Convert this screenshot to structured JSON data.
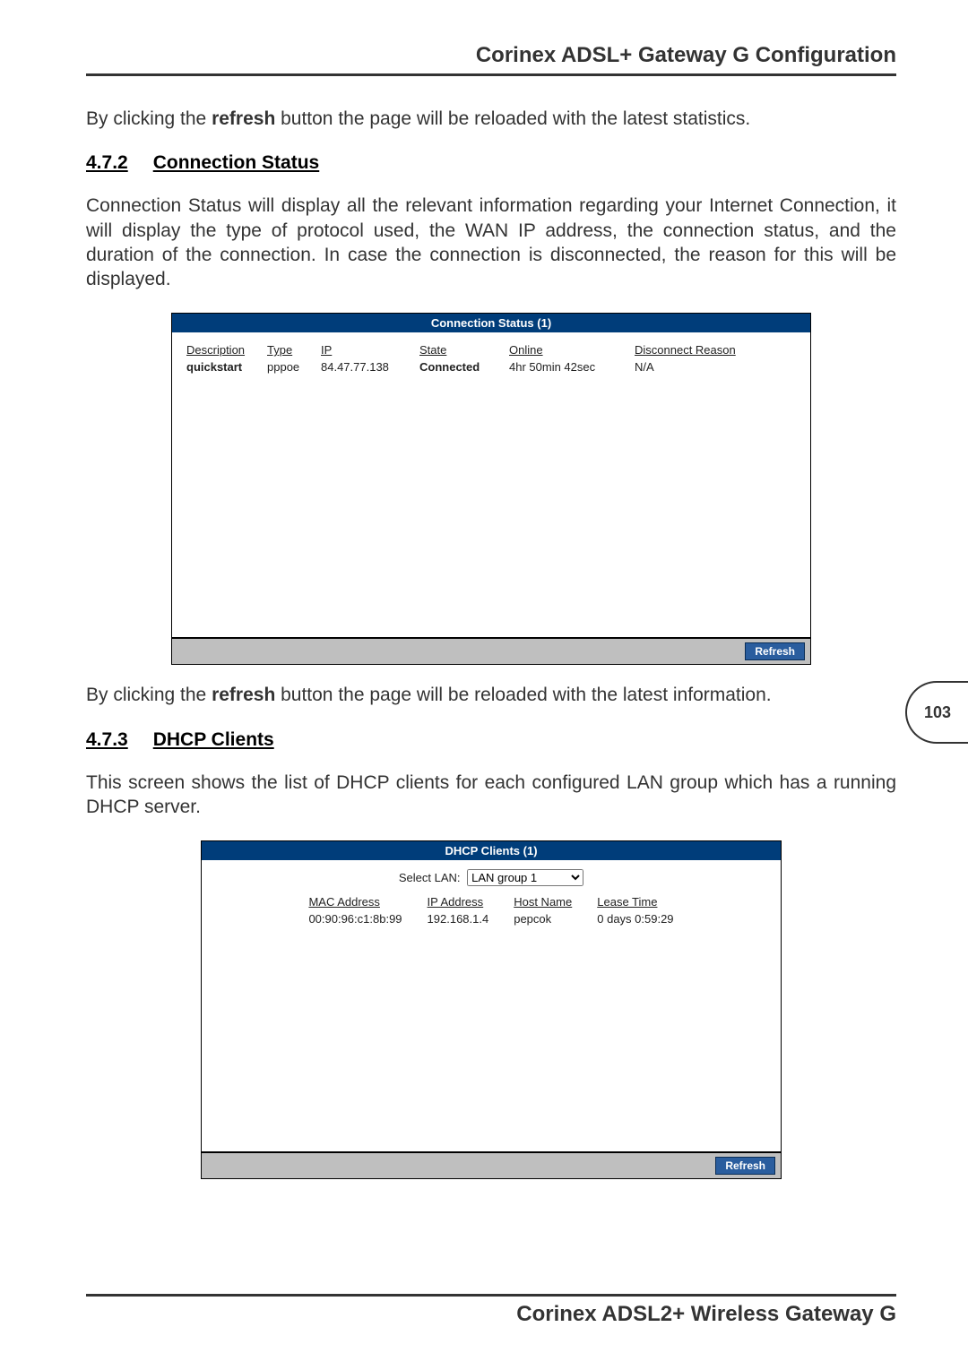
{
  "header": {
    "title": "Corinex ADSL+ Gateway G Configuration"
  },
  "para1_before": "By clicking the ",
  "para1_bold": "refresh",
  "para1_after": " button the page will be reloaded with the latest statistics.",
  "section472": {
    "num": "4.7.2",
    "title": "Connection Status"
  },
  "para2": "Connection Status will display all the relevant information regarding your Internet Connection, it will display the type of protocol used, the WAN IP address, the connection status, and the duration of the connection. In case the connection is disconnected, the reason for this will be displayed.",
  "conn_panel": {
    "title": "Connection Status (1)",
    "cols": {
      "c1": "Description",
      "c2": "Type",
      "c3": "IP",
      "c4": "State",
      "c5": "Online",
      "c6": "Disconnect Reason"
    },
    "row": {
      "c1": "quickstart",
      "c2": "pppoe",
      "c3": "84.47.77.138",
      "c4": "Connected",
      "c5": "4hr 50min 42sec",
      "c6": "N/A"
    },
    "refresh": "Refresh"
  },
  "para3_before": "By clicking the ",
  "para3_bold": "refresh",
  "para3_after": " button the page will be reloaded with the latest information.",
  "section473": {
    "num": "4.7.3",
    "title": "DHCP Clients"
  },
  "para4": "This screen shows the list of DHCP clients for each configured LAN group which has a running DHCP server.",
  "dhcp_panel": {
    "title": "DHCP Clients (1)",
    "select_label": "Select LAN:",
    "select_value": "LAN group 1",
    "cols": {
      "c1": "MAC Address",
      "c2": "IP Address",
      "c3": "Host Name",
      "c4": "Lease Time"
    },
    "row": {
      "c1": "00:90:96:c1:8b:99",
      "c2": "192.168.1.4",
      "c3": "pepcok",
      "c4": "0 days 0:59:29"
    },
    "refresh": "Refresh"
  },
  "page_number": "103",
  "footer": {
    "title": "Corinex ADSL2+ Wireless Gateway G"
  }
}
